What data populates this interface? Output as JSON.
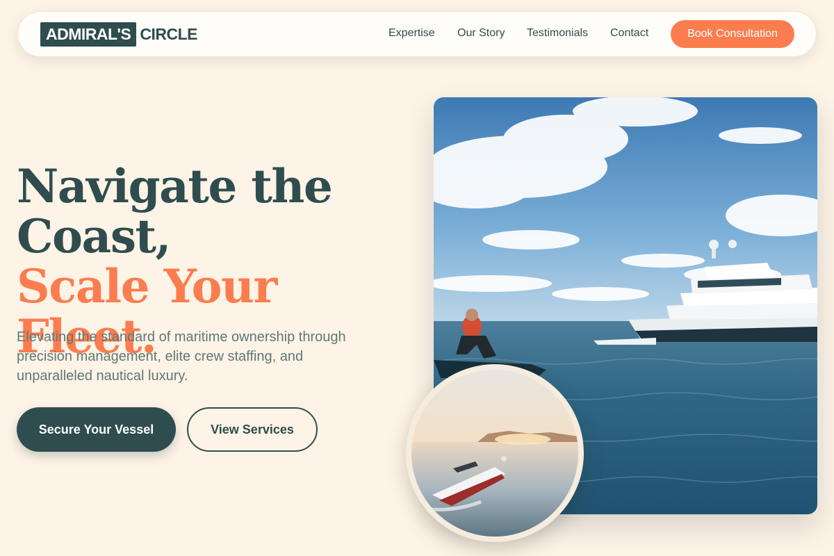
{
  "brand": {
    "logo_box": "ADMIRAL'S",
    "logo_text": "CIRCLE"
  },
  "nav": {
    "links": [
      "Expertise",
      "Our Story",
      "Testimonials",
      "Contact"
    ],
    "cta": "Book Consultation"
  },
  "hero": {
    "headline_line1": "Navigate the",
    "headline_line2": "Coast,",
    "headline_line3": "Scale Your Fleet.",
    "subtitle": "Elevating the standard of maritime ownership through precision management, elite crew staffing, and unparalleled nautical luxury.",
    "primary_button": "Secure Your Vessel",
    "secondary_button": "View Services"
  },
  "colors": {
    "background": "#fdf3e6",
    "brand_dark": "#2f4d4e",
    "accent": "#fb7d4f"
  }
}
